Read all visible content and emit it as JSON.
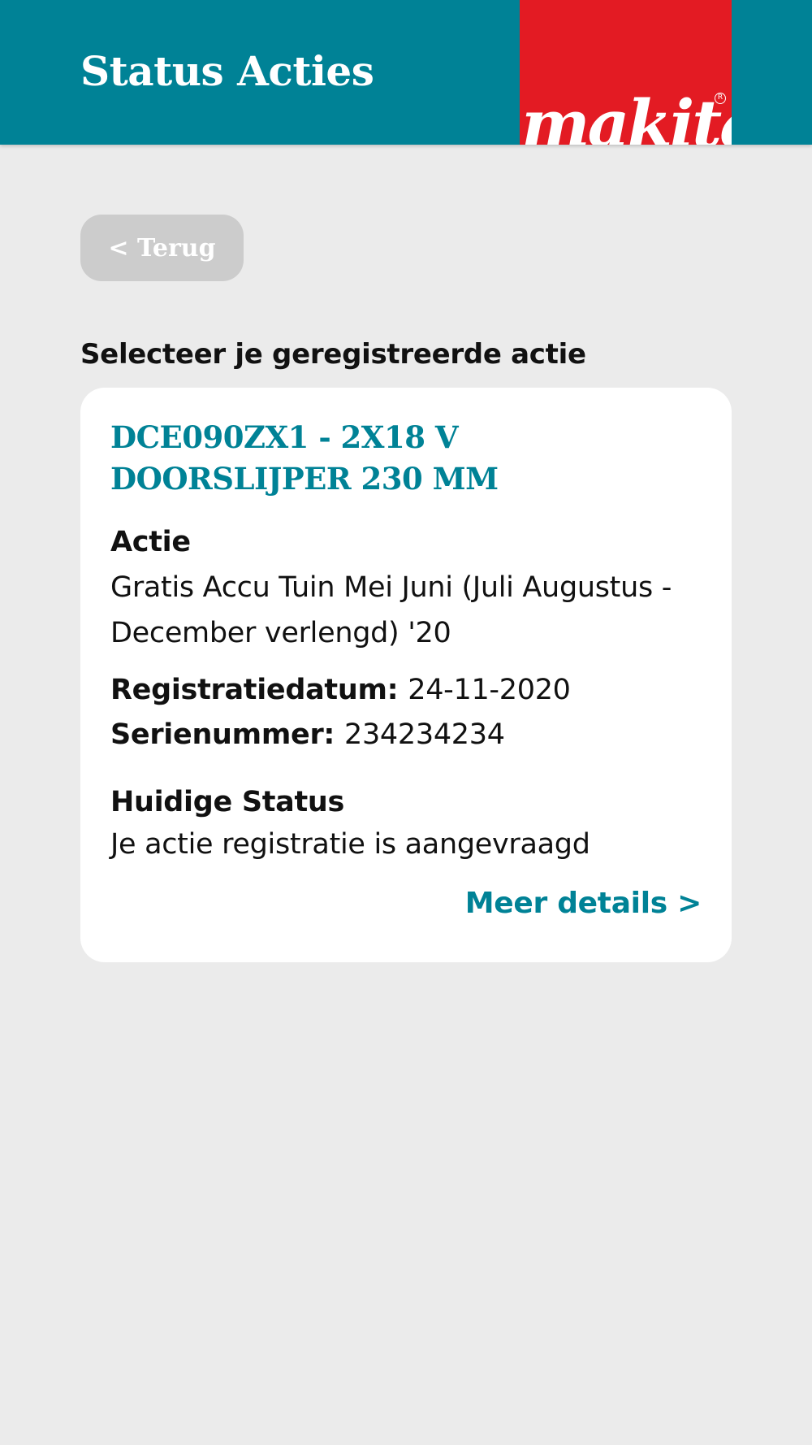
{
  "header": {
    "title": "Status Acties",
    "brand_color": "#008296"
  },
  "logo": {
    "text": "makita",
    "registered_mark": "R",
    "bg_color": "#e31b23"
  },
  "back_button": {
    "label": "< Terug"
  },
  "section": {
    "label": "Selecteer je geregistreerde actie"
  },
  "card": {
    "product_title": "DCE090ZX1 - 2X18 V DOORSLIJPER 230 MM",
    "action_label": "Actie",
    "action_value": "Gratis Accu Tuin Mei Juni (Juli Augustus - December verlengd) '20",
    "registration_label": "Registratiedatum:",
    "registration_value": "24-11-2020",
    "serial_label": "Serienummer:",
    "serial_value": "234234234",
    "status_label": "Huidige Status",
    "status_value": "Je actie registratie is aangevraagd",
    "more_details": "Meer details >"
  }
}
